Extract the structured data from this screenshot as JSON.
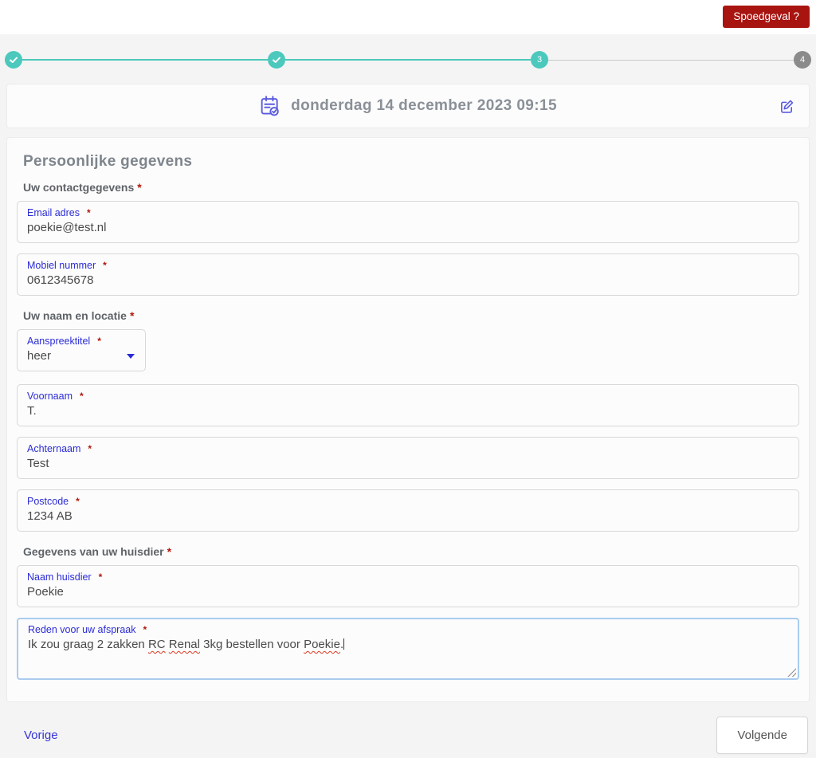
{
  "header": {
    "emergency_button_label": "Spoedgeval ?"
  },
  "stepper": {
    "steps": [
      {
        "state": "done",
        "icon": "check"
      },
      {
        "state": "done",
        "icon": "check"
      },
      {
        "state": "active",
        "number": "3"
      },
      {
        "state": "upcoming",
        "number": "4"
      }
    ]
  },
  "datebar": {
    "datetime": "donderdag 14 december 2023 09:15",
    "icons": [
      "calendar-check-icon",
      "edit-icon"
    ]
  },
  "form": {
    "title": "Persoonlijke gegevens",
    "required_marker": "*",
    "section_contact": "Uw contactgegevens",
    "section_name_location": "Uw naam en locatie",
    "section_pet": "Gegevens van uw huisdier",
    "fields": {
      "email": {
        "label": "Email adres",
        "value": "poekie@test.nl"
      },
      "mobile": {
        "label": "Mobiel nummer",
        "value": "0612345678"
      },
      "salutation": {
        "label": "Aanspreektitel",
        "value": "heer"
      },
      "first_name": {
        "label": "Voornaam",
        "value": "T."
      },
      "last_name": {
        "label": "Achternaam",
        "value": "Test"
      },
      "postcode": {
        "label": "Postcode",
        "value": "1234 AB"
      },
      "pet_name": {
        "label": "Naam huisdier",
        "value": "Poekie"
      },
      "reason": {
        "label": "Reden voor uw afspraak",
        "value": "Ik zou graag 2 zakken RC Renal 3kg bestellen voor Poekie.",
        "segments": {
          "s1": "Ik zou graag 2 zakken ",
          "m1": "RC",
          "s2": " ",
          "m2": "Renal",
          "s3": " 3kg bestellen voor ",
          "m3": "Poekie",
          "s4": "."
        }
      }
    }
  },
  "footer": {
    "back_label": "Vorige",
    "next_label": "Volgende"
  },
  "colors": {
    "accent_teal": "#4cc8bd",
    "accent_purple": "#5a5be0",
    "label_blue": "#2b2cd5",
    "required_red": "#b3170d",
    "emergency_red": "#a81410",
    "step_gray": "#8b8b8b",
    "canvas_gray": "#f4f4f4",
    "textarea_focus_border": "#a9ccee"
  }
}
